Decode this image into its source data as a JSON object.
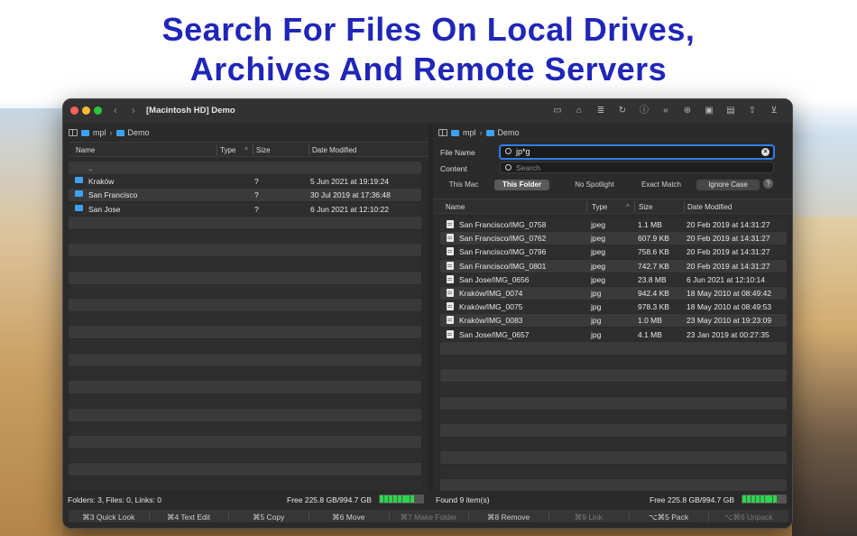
{
  "headline": {
    "line1": "Search For Files On Local Drives,",
    "line2": "Archives And Remote Servers"
  },
  "window": {
    "title": "[Macintosh HD] Demo",
    "toolbar_icons": [
      "monitor-icon",
      "home-icon",
      "list-icon",
      "refresh-icon",
      "info-icon",
      "double-chevron-left-icon",
      "globe-icon",
      "finder-icon",
      "terminal-icon",
      "share-icon",
      "download-icon"
    ]
  },
  "left": {
    "breadcrumb": [
      "mpl",
      "Demo"
    ],
    "columns": {
      "name": "Name",
      "type": "Type",
      "size": "Size",
      "date": "Date Modified"
    },
    "rows": [
      {
        "name": "..",
        "type": "",
        "size": "",
        "date": ""
      },
      {
        "name": "Kraków",
        "type": "",
        "size": "?",
        "date": "5 Jun 2021 at 19:19:24"
      },
      {
        "name": "San Francisco",
        "type": "",
        "size": "?",
        "date": "30 Jul 2019 at 17:36:48"
      },
      {
        "name": "San Jose",
        "type": "",
        "size": "?",
        "date": "6 Jun 2021 at 12:10:22"
      }
    ],
    "status_left": "Folders: 3, Files: 0, Links: 0",
    "status_free": "Free 225.8 GB/994.7 GB"
  },
  "right": {
    "breadcrumb": [
      "mpl",
      "Demo"
    ],
    "search": {
      "file_name_label": "File Name",
      "file_name_value": "jp*g",
      "content_label": "Content",
      "content_placeholder": "Search"
    },
    "scopes": [
      "This Mac",
      "This Folder",
      "No Spotlight",
      "Exact Match",
      "Ignore Case"
    ],
    "help": "?",
    "columns": {
      "name": "Name",
      "type": "Type",
      "size": "Size",
      "date": "Date Modified"
    },
    "rows": [
      {
        "name": "San Francisco/IMG_0758",
        "type": "jpeg",
        "size": "1.1 MB",
        "date": "20 Feb 2019 at 14:31:27"
      },
      {
        "name": "San Francisco/IMG_0762",
        "type": "jpeg",
        "size": "607.9 KB",
        "date": "20 Feb 2019 at 14:31:27"
      },
      {
        "name": "San Francisco/IMG_0796",
        "type": "jpeg",
        "size": "758.6 KB",
        "date": "20 Feb 2019 at 14:31:27"
      },
      {
        "name": "San Francisco/IMG_0801",
        "type": "jpeg",
        "size": "742.7 KB",
        "date": "20 Feb 2019 at 14:31:27"
      },
      {
        "name": "San Jose/IMG_0656",
        "type": "jpeg",
        "size": "23.8 MB",
        "date": "6 Jun 2021 at 12:10:14"
      },
      {
        "name": "Kraków/IMG_0074",
        "type": "jpg",
        "size": "942.4 KB",
        "date": "18 May 2010 at 08:49:42"
      },
      {
        "name": "Kraków/IMG_0075",
        "type": "jpg",
        "size": "978.3 KB",
        "date": "18 May 2010 at 08:49:53"
      },
      {
        "name": "Kraków/IMG_0083",
        "type": "jpg",
        "size": "1.0 MB",
        "date": "23 May 2010 at 19:23:09"
      },
      {
        "name": "San Jose/IMG_0657",
        "type": "jpg",
        "size": "4.1 MB",
        "date": "23 Jan 2019 at 00:27:35"
      }
    ],
    "status_left": "Found 9 item(s)",
    "status_free": "Free 225.8 GB/994.7 GB"
  },
  "fkeys": [
    {
      "label": "⌘3 Quick Look",
      "enabled": true
    },
    {
      "label": "⌘4 Text Edit",
      "enabled": true
    },
    {
      "label": "⌘5 Copy",
      "enabled": true
    },
    {
      "label": "⌘6 Move",
      "enabled": true
    },
    {
      "label": "⌘7 Make Folder",
      "enabled": false
    },
    {
      "label": "⌘8 Remove",
      "enabled": true
    },
    {
      "label": "⌘9 Link",
      "enabled": false
    },
    {
      "label": "⌥⌘5 Pack",
      "enabled": true
    },
    {
      "label": "⌥⌘6 Unpack",
      "enabled": false
    }
  ],
  "disk_used_fraction": 0.77
}
